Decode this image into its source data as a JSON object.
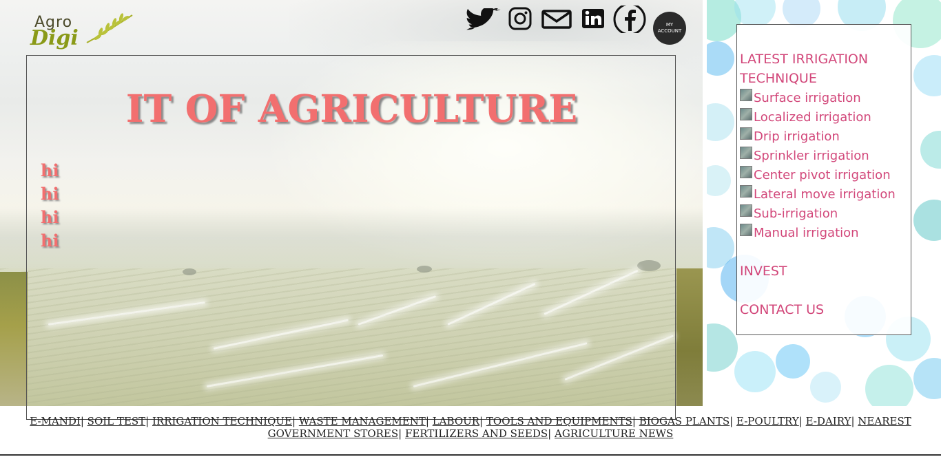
{
  "logo": {
    "word1": "Agro",
    "word2": "Digi"
  },
  "social": {
    "icons": [
      "twitter-icon",
      "instagram-icon",
      "mail-icon",
      "linkedin-icon",
      "facebook-icon"
    ],
    "account_line1": "MY",
    "account_line2": "ACCOUNT"
  },
  "main": {
    "title": "IT OF AGRICULTURE",
    "lines": [
      "hi",
      "hi",
      "hi",
      "hi"
    ]
  },
  "sidebar": {
    "heading_line1": "LATEST IRRIGATION",
    "heading_line2": "TECHNIQUE",
    "items": [
      "Surface irrigation",
      "Localized irrigation",
      "Drip irrigation",
      "Sprinkler irrigation",
      "Center pivot irrigation",
      "Lateral move irrigation",
      "Sub-irrigation",
      "Manual irrigation"
    ],
    "invest": "INVEST",
    "contact": "CONTACT US"
  },
  "bottom_nav": {
    "links": [
      "E-MANDI",
      "SOIL TEST",
      "IRRIGATION TECHNIQUE",
      "WASTE MANAGEMENT",
      "LABOUR",
      "TOOLS AND EQUIPMENTS",
      "BIOGAS PLANTS",
      "E-POULTRY",
      "E-DAIRY",
      "NEAREST GOVERNMENT STORES",
      "FERTILIZERS AND SEEDS",
      "AGRICULTURE NEWS"
    ],
    "separator": "|"
  },
  "colors": {
    "title": "#f26f6f",
    "sidebar_text": "#d2477a",
    "account_bg": "#2b2b2b"
  }
}
